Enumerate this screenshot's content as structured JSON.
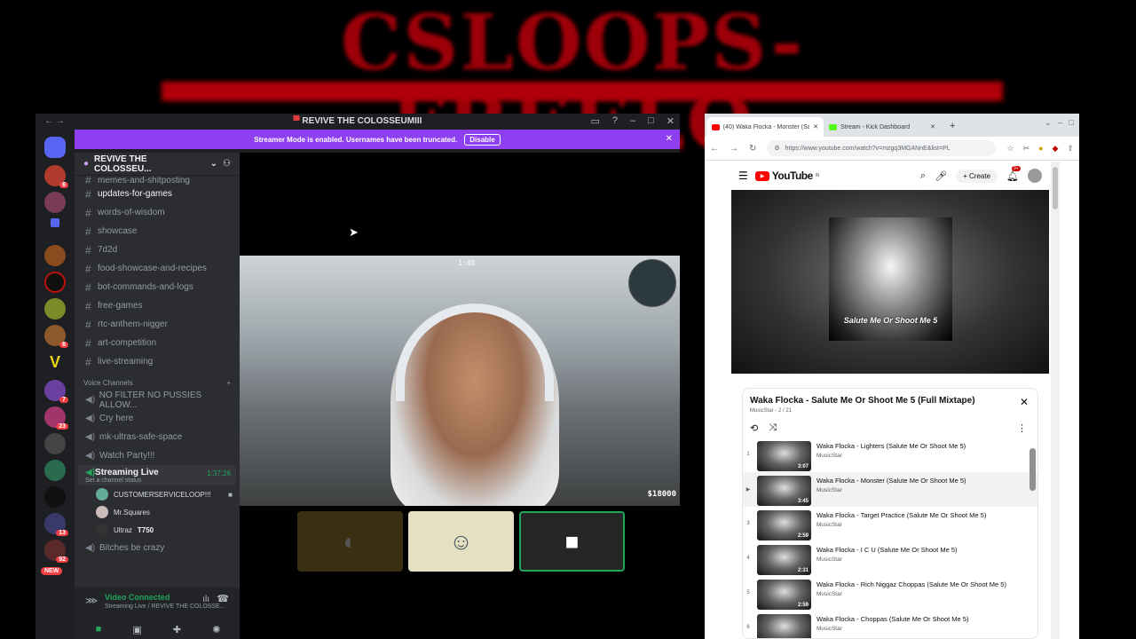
{
  "banner": {
    "text": "CSLOOPS-FREELO"
  },
  "discord": {
    "window_title": "REVIVE THE COLOSSEUMIII",
    "streamer_mode": {
      "text": "Streamer Mode is enabled. Usernames have been truncated.",
      "button": "Disable"
    },
    "server_name": "REVIVE THE COLOSSEU...",
    "text_channels": [
      "memes-and-shitposting",
      "updates-for-games",
      "words-of-wisdom",
      "showcase",
      "7d2d",
      "food-showcase-and-recipes",
      "bot-commands-and-logs",
      "free-games",
      "rtc-anthem-nigger",
      "art-competition",
      "live-streaming"
    ],
    "voice_category": "Voice Channels",
    "voice_channels": [
      "NO FILTER NO PUSSIES ALLOW...",
      "Cry here",
      "mk-ultras-safe-space",
      "Watch Party!!!"
    ],
    "active_voice": {
      "name": "Streaming Live",
      "time": "1:37:26",
      "status": "Set a channel status",
      "members": [
        "CUSTOMERSERVICELOOP!!!",
        "Mr.Squares",
        "Ultraz"
      ],
      "member_tag": "T750"
    },
    "voice_after": "Bitches be crazy",
    "guild_badges": [
      "6",
      "23",
      "13",
      "92",
      "7"
    ],
    "guild_new": "NEW",
    "connection": {
      "title": "Video Connected",
      "subtitle": "Streaming Live / REVIVE THE COLOSSE..."
    },
    "hud": {
      "score": "1:48",
      "money": "$18000"
    }
  },
  "browser": {
    "tabs": [
      {
        "label": "(40) Waka Flocka - Monster (Sal",
        "color": "#ff0000"
      },
      {
        "label": "Stream - Kick Dashboard",
        "color": "#53fc18"
      }
    ],
    "url": "https://www.youtube.com/watch?v=mzgq3MGANnE&list=PL",
    "youtube": {
      "logo": "YouTube",
      "region": "IN",
      "create_label": "Create",
      "notif_count": "9+",
      "cover_text": "Salute Me Or Shoot Me 5",
      "playlist_title": "Waka Flocka - Salute Me Or Shoot Me 5 (Full Mixtape)",
      "playlist_sub": "MusicStar - 2 / 21",
      "items": [
        {
          "idx": "1",
          "title": "Waka Flocka - Lighters (Salute Me Or Shoot Me 5)",
          "artist": "MusicStar",
          "duration": "3:07"
        },
        {
          "idx": "▶",
          "title": "Waka Flocka - Monster (Salute Me Or Shoot Me 5)",
          "artist": "MusicStar",
          "duration": "3:45"
        },
        {
          "idx": "3",
          "title": "Waka Flocka - Target Practice (Salute Me Or Shoot Me 5)",
          "artist": "MusicStar",
          "duration": "2:59"
        },
        {
          "idx": "4",
          "title": "Waka Flocka - I C U (Salute Me Or Shoot Me 5)",
          "artist": "MusicStar",
          "duration": "2:31"
        },
        {
          "idx": "5",
          "title": "Waka Flocka - Rich Niggaz Choppas (Salute Me Or Shoot Me 5)",
          "artist": "MusicStar",
          "duration": "2:59"
        },
        {
          "idx": "6",
          "title": "Waka Flocka - Choppas (Salute Me Or Shoot Me 5)",
          "artist": "MusicStar",
          "duration": ""
        }
      ]
    }
  },
  "colors": {
    "discord_accent": "#8e3ff0",
    "discord_green": "#23a55a",
    "youtube_red": "#ff0000"
  }
}
